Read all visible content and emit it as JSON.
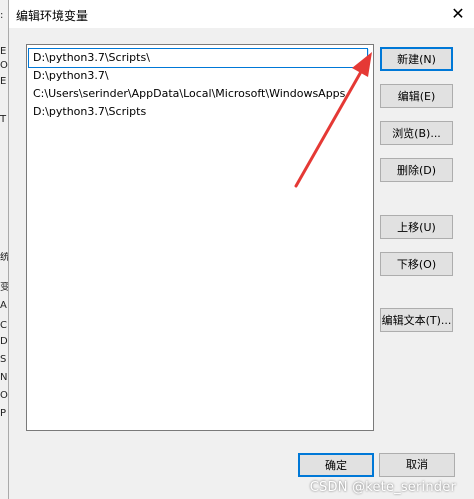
{
  "window": {
    "title": "编辑环境变量",
    "close_glyph": "✕"
  },
  "list": {
    "items": [
      "D:\\python3.7\\Scripts\\",
      "D:\\python3.7\\",
      "C:\\Users\\serinder\\AppData\\Local\\Microsoft\\WindowsApps",
      "D:\\python3.7\\Scripts"
    ],
    "selected_index": 0
  },
  "buttons": {
    "new": "新建(N)",
    "edit": "编辑(E)",
    "browse": "浏览(B)...",
    "delete": "删除(D)",
    "move_up": "上移(U)",
    "move_down": "下移(O)",
    "edit_text": "编辑文本(T)...",
    "ok": "确定",
    "cancel": "取消"
  },
  "watermark": "CSDN @kete_serinder",
  "colors": {
    "accent": "#0078d7",
    "selection": "#cce8ff",
    "annotation_arrow": "#e53935"
  }
}
